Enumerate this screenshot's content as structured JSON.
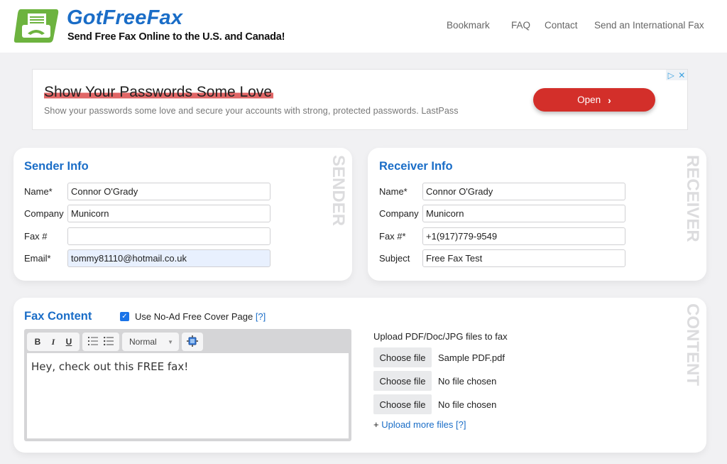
{
  "header": {
    "brand": "GotFreeFax",
    "tagline": "Send Free Fax Online to the U.S. and Canada!",
    "nav": [
      "Bookmark",
      "FAQ",
      "Contact",
      "Send an International Fax"
    ]
  },
  "ad": {
    "title": "Show Your Passwords Some Love",
    "description": "Show your passwords some love and secure your accounts with strong, protected passwords. LastPass",
    "cta": "Open",
    "cta_icon": "chevron-right",
    "choices_icon": "adchoices-triangle",
    "close_icon": "close-x"
  },
  "sender": {
    "title": "Sender Info",
    "side_label": "SENDER",
    "fields": [
      {
        "label": "Name*",
        "value": "Connor O'Grady"
      },
      {
        "label": "Company",
        "value": "Municorn"
      },
      {
        "label": "Fax #",
        "value": ""
      },
      {
        "label": "Email*",
        "value": "tommy81110@hotmail.co.uk"
      }
    ]
  },
  "receiver": {
    "title": "Receiver Info",
    "side_label": "RECEIVER",
    "fields": [
      {
        "label": "Name*",
        "value": "Connor O'Grady"
      },
      {
        "label": "Company",
        "value": "Municorn"
      },
      {
        "label": "Fax #*",
        "value": "+1(917)779-9549"
      },
      {
        "label": "Subject",
        "value": "Free Fax Test"
      }
    ]
  },
  "content": {
    "title": "Fax Content",
    "side_label": "CONTENT",
    "cover_page": {
      "label": "Use No-Ad Free Cover Page",
      "checked": true,
      "help": "[?]"
    },
    "toolbar": {
      "bold": "B",
      "italic": "I",
      "underline": "U",
      "format": "Normal"
    },
    "body_text": "Hey, check out this FREE fax!",
    "upload": {
      "label": "Upload PDF/Doc/JPG files to fax",
      "button_label": "Choose file",
      "files": [
        "Sample PDF.pdf",
        "No file chosen",
        "No file chosen"
      ],
      "more_prefix": "+",
      "more_link": "Upload more files",
      "more_help": "[?]"
    }
  }
}
